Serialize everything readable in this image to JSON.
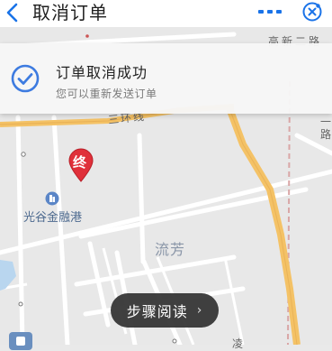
{
  "header": {
    "title": "取消订单",
    "back_icon": "chevron-left-icon",
    "more_icon": "more-dots-icon",
    "close_icon": "close-circle-icon",
    "accent": "#1a73e8"
  },
  "banner": {
    "title": "订单取消成功",
    "subtitle": "您可以重新发送订单",
    "icon": "check-circle-icon",
    "accent": "#3d7be0"
  },
  "map": {
    "labels": {
      "road_top": "高新二路",
      "road_right": "一路",
      "ring_road": "三环线",
      "poi": "光谷金融港",
      "district": "流芳",
      "bottom_road": "凌"
    },
    "destination_marker": "终",
    "marker_color": "#e0303a",
    "road_color": "#f4c266"
  },
  "footer": {
    "step_button": "步骤阅读",
    "step_icon": "chevron-right-icon"
  }
}
